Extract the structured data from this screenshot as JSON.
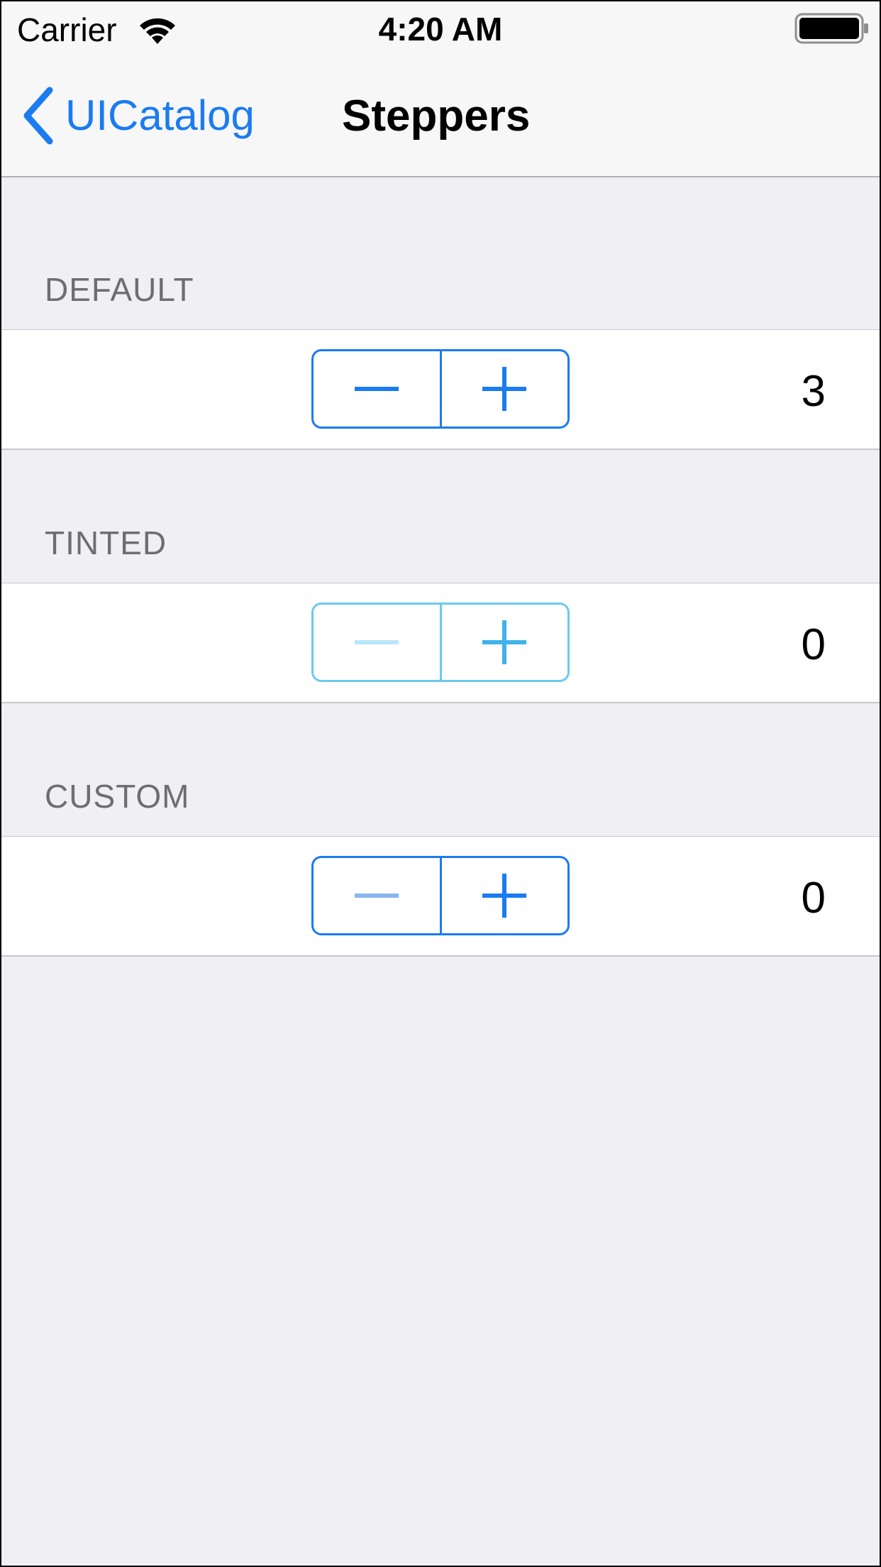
{
  "status_bar": {
    "carrier": "Carrier",
    "time": "4:20 AM",
    "wifi_icon": "wifi-icon",
    "battery_icon": "battery-icon"
  },
  "nav": {
    "back_label": "UICatalog",
    "back_icon": "chevron-left-icon",
    "title": "Steppers",
    "accent_color": "#1A7CF0"
  },
  "sections": [
    {
      "header": "DEFAULT",
      "value": "3",
      "decrement_icon": "minus-icon",
      "increment_icon": "plus-icon"
    },
    {
      "header": "TINTED",
      "value": "0",
      "decrement_icon": "minus-icon",
      "increment_icon": "plus-icon",
      "tint_color": "#6CC9EF"
    },
    {
      "header": "CUSTOM",
      "value": "0",
      "decrement_icon": "minus-icon",
      "increment_icon": "plus-icon"
    }
  ]
}
